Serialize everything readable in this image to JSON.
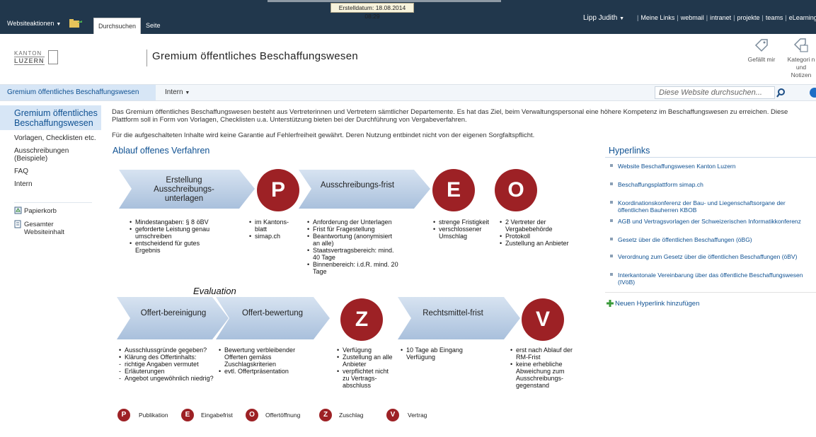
{
  "ribbon": {
    "stamp": "Erstelldatum: 18.08.2014 08:29",
    "site_actions": "Websiteaktionen",
    "tabs": [
      "Durchsuchen",
      "Seite"
    ],
    "user": "Lipp Judith",
    "top_links": [
      "Meine Links",
      "webmail",
      "intranet",
      "projekte",
      "teams",
      "eLearning"
    ],
    "accent": "#21374c"
  },
  "header": {
    "logo_line1": "KANTON",
    "logo_line2": "LUZERN",
    "title": "Gremium öffentliches Beschaffungswesen",
    "actions": [
      {
        "icon": "thumbs-up-tag-icon",
        "label": "Gefällt mir"
      },
      {
        "icon": "tag-note-icon",
        "label": "Kategori n und Notizen"
      }
    ]
  },
  "navbar": {
    "home": "Gremium öffentliches Beschaffungswesen",
    "intern": "Intern",
    "search_placeholder": "Diese Website durchsuchen..."
  },
  "leftnav": {
    "title": "Gremium öffentliches Beschaffungswesen",
    "items": [
      "Vorlagen, Checklisten etc.",
      "Ausschreibungen (Beispiele)",
      "FAQ",
      "Intern"
    ],
    "footer": [
      "Papierkorb",
      "Gesamter Websiteinhalt"
    ]
  },
  "main": {
    "intro": "Das Gremium öffentliches Beschaffungswesen besteht aus Vertreterinnen und Vertretern sämtlicher Departemente. Es hat das Ziel, beim Verwaltungspersonal eine höhere Kompetenz im Beschaffungswesen zu erreichen. Diese Plattform soll in Form von Vorlagen, Checklisten u.a. Unterstützung bieten bei der Durchführung von Vergabeverfahren.",
    "disclaimer": "Für die aufgeschalteten Inhalte wird keine Garantie auf Fehlerfreiheit gewährt. Deren Nutzung entbindet nicht von der eigenen Sorgfaltspflicht.",
    "section_title": "Ablauf offenes Verfahren"
  },
  "diagram": {
    "row1": {
      "arrow1": "Erstellung Ausschreibungs-unterlagen",
      "circle_p": "P",
      "arrow2": "Ausschreibungs-frist",
      "circle_e": "E",
      "circle_o": "O"
    },
    "row1_bullets": {
      "col1": [
        "Mindestangaben: § 8 öBV",
        "geforderte Leistung genau umschreiben",
        "entscheidend für gutes Ergebnis"
      ],
      "col2": [
        "im Kantons-blatt",
        "simap.ch"
      ],
      "col3": [
        "Anforderung der Unterlagen",
        "Frist für Fragestellung",
        "Beantwortung (anonymisiert an alle)",
        "Staatsvertragsbereich: mind. 40 Tage",
        "Binnenbereich: i.d.R. mind. 20 Tage"
      ],
      "col4": [
        "strenge Fristigkeit",
        "verschlossener Umschlag"
      ],
      "col5": [
        "2 Vertreter der Vergabebehörde",
        "Protokoll",
        "Zustellung an Anbieter"
      ]
    },
    "evaluation": "Evaluation",
    "row2": {
      "arrow1": "Offert-bereinigung",
      "arrow2": "Offert-bewertung",
      "circle_z": "Z",
      "arrow3": "Rechtsmittel-frist",
      "circle_v": "V"
    },
    "row2_bullets": {
      "col1": [
        {
          "t": "Ausschlussgründe gegeben?",
          "k": "b"
        },
        {
          "t": "Klärung des Offertinhalts:",
          "k": "b"
        },
        {
          "t": "richtige Angaben vermutet",
          "k": "d"
        },
        {
          "t": "Erläuterungen",
          "k": "d"
        },
        {
          "t": "Angebot ungewöhnlich niedrig?",
          "k": "d"
        }
      ],
      "col2": [
        "Bewertung verbleibender Offerten gemäss Zuschlagskriterien",
        "evtl. Offertpräsentation"
      ],
      "col3": [
        "Verfügung",
        "Zustellung an alle Anbieter",
        "verpflichtet nicht zu Vertrags-abschluss"
      ],
      "col4": [
        "10 Tage ab Eingang Verfügung"
      ],
      "col5": [
        "erst nach Ablauf der RM-Frist",
        "keine erhebliche Abweichung zum Ausschreibungs-gegenstand"
      ]
    },
    "legend": [
      {
        "letter": "P",
        "label": "Publikation"
      },
      {
        "letter": "E",
        "label": "Eingabefrist"
      },
      {
        "letter": "O",
        "label": "Offertöffnung"
      },
      {
        "letter": "Z",
        "label": "Zuschlag"
      },
      {
        "letter": "V",
        "label": "Vertrag"
      }
    ],
    "circle_color": "#9d2125",
    "arrow_color": "#b9cde3"
  },
  "hyperlinks": {
    "title": "Hyperlinks",
    "items": [
      "Website Beschaffungswesen Kanton Luzern",
      "Beschaffungsplattform simap.ch",
      "Koordinationskonferenz der Bau- und Liegenschaftsorgane der öffentlichen Bauherren KBOB",
      "AGB und Vertragsvorlagen der Schweizerischen Informatikkonferenz",
      "Gesetz über die öffentlichen Beschaffungen (öBG)",
      "Verordnung zum Gesetz über die öffentlichen Beschaffungen (öBV)",
      "Interkantonale Vereinbarung über das öffentliche Beschaffungswesen (IVöB)"
    ],
    "add": "Neuen Hyperlink hinzufügen"
  }
}
